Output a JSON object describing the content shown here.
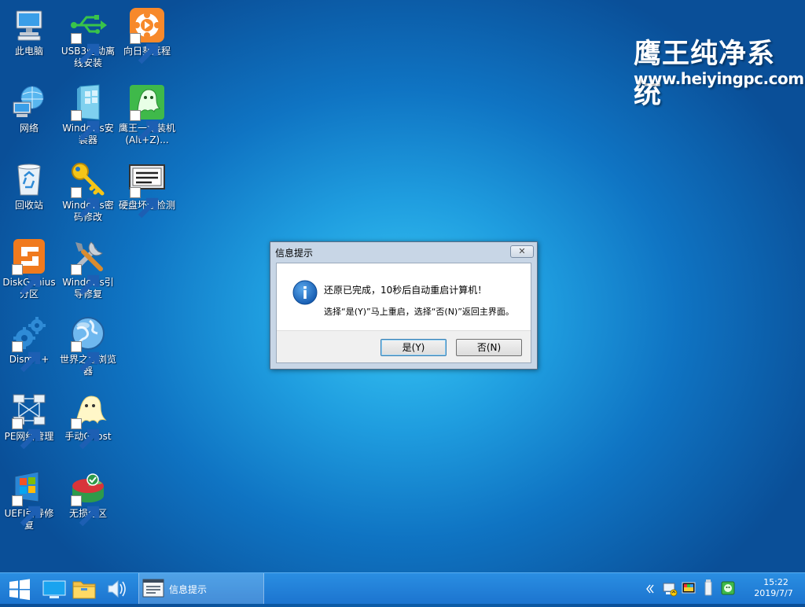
{
  "desktop": {
    "icons": [
      {
        "label": "此电脑",
        "icon": "computer-icon"
      },
      {
        "label": "网络",
        "icon": "network-icon"
      },
      {
        "label": "回收站",
        "icon": "recycle-bin-icon"
      },
      {
        "label": "DiskGenius分区",
        "icon": "diskgenius-icon"
      },
      {
        "label": "Dism++",
        "icon": "gears-icon"
      },
      {
        "label": "PE网络管理",
        "icon": "network-manager-icon"
      },
      {
        "label": "UEFI引导修复",
        "icon": "uefi-repair-icon"
      },
      {
        "label": "USB3驱动离线安装",
        "icon": "usb-icon"
      },
      {
        "label": "Windows安装器",
        "icon": "windows-installer-icon"
      },
      {
        "label": "Windows密码修改",
        "icon": "key-icon"
      },
      {
        "label": "Windows引导修复",
        "icon": "tools-icon"
      },
      {
        "label": "世界之窗浏览器",
        "icon": "globe-browser-icon"
      },
      {
        "label": "手动Ghost",
        "icon": "ghost-icon"
      },
      {
        "label": "无损分区",
        "icon": "partition-icon"
      },
      {
        "label": "向日葵远程",
        "icon": "sunflower-icon"
      },
      {
        "label": "鹰王一键装机(Alt+Z)...",
        "icon": "ghost-green-icon"
      },
      {
        "label": "硬盘坏道检测",
        "icon": "disk-check-icon"
      }
    ]
  },
  "watermark": {
    "title": "鹰王纯净系统",
    "url": "www.heiyingpc.com"
  },
  "dialog": {
    "title": "信息提示",
    "close_label": "✕",
    "icon": "info-icon",
    "message_line1": "还原已完成，10秒后自动重启计算机！",
    "message_line2": "选择“是(Y)”马上重启，选择“否(N)”返回主界面。",
    "yes_label": "是(Y)",
    "no_label": "否(N)"
  },
  "taskbar": {
    "start_icon": "windows-start-icon",
    "pinned": [
      "desktop-icon",
      "file-explorer-icon",
      "speaker-icon"
    ],
    "active_window": {
      "label": "信息提示",
      "icon": "window-app-icon"
    },
    "tray": [
      "chevron-left-icon",
      "network-tray-icon",
      "display-tray-icon",
      "usb-tray-icon",
      "app-tray-icon"
    ],
    "clock": {
      "time": "15:22",
      "date": "2019/7/7"
    }
  },
  "colors": {
    "desktop_center": "#38c6f4",
    "desktop_edge": "#0a4f98",
    "taskbar": "#1f7fd6",
    "info_icon": "#1f6fc4"
  }
}
